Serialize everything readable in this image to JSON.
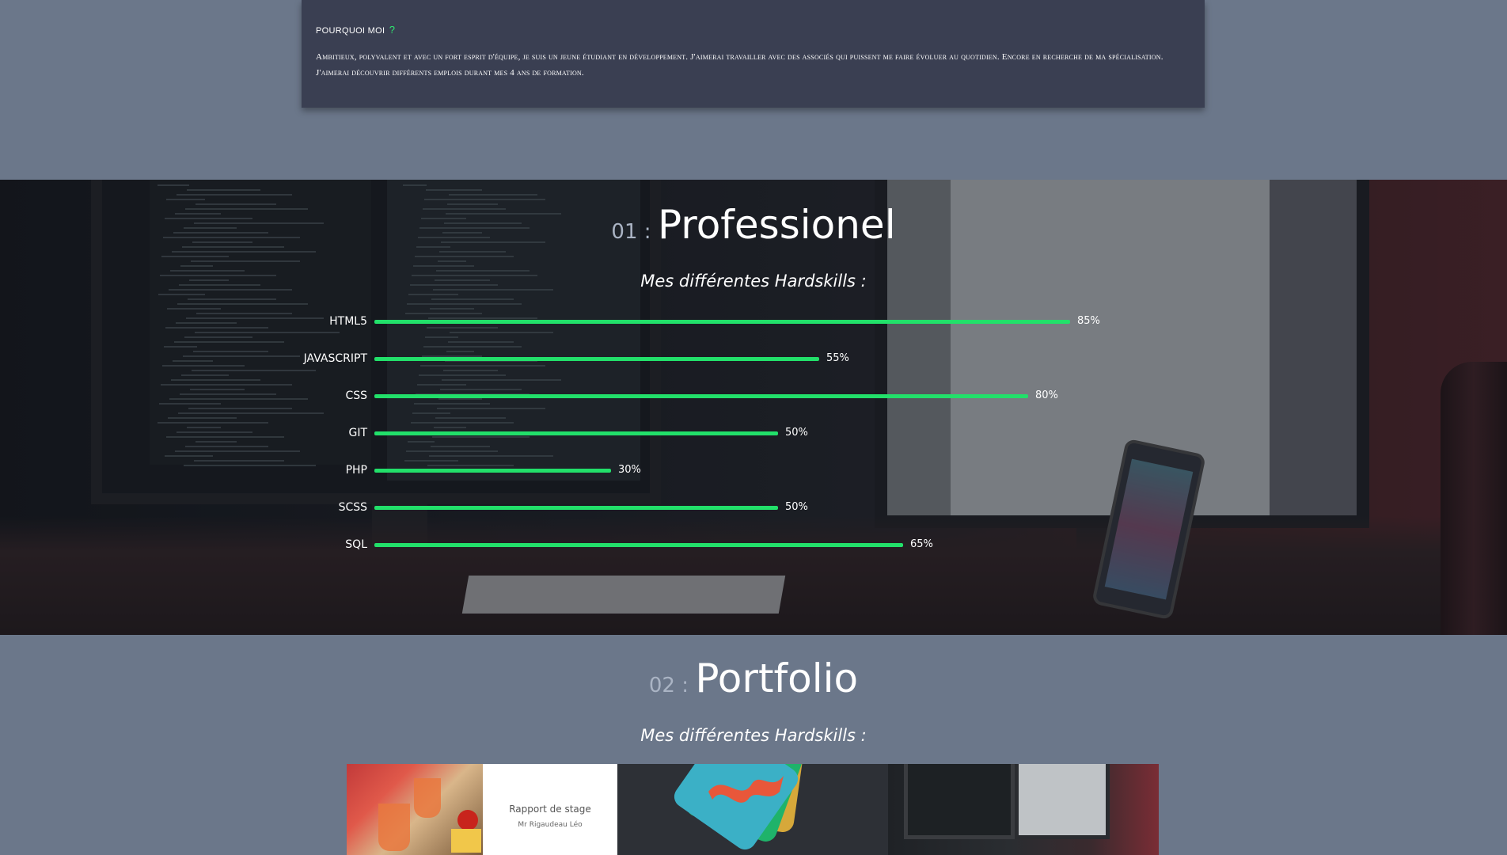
{
  "about": {
    "title": "POURQUOI MOI",
    "title_mark": "?",
    "text": "Ambitieux, polyvalent et avec un fort esprit d'équipe, je suis un jeune étudiant en développement. J'aimerai travailler avec des associés qui puissent me faire évoluer au quotidien. Encore en recherche de ma spécialisation. J'aimerai découvrir différents emplois durant mes 4 ans de formation."
  },
  "professional": {
    "number": "01 :",
    "title": "Professionel",
    "subtitle": "Mes différentes Hardskills :",
    "skills": [
      {
        "label": "HTML5",
        "percent": 85,
        "percent_text": "85%"
      },
      {
        "label": "JAVASCRIPT",
        "percent": 55,
        "percent_text": "55%"
      },
      {
        "label": "CSS",
        "percent": 80,
        "percent_text": "80%"
      },
      {
        "label": "GIT",
        "percent": 50,
        "percent_text": "50%"
      },
      {
        "label": "PHP",
        "percent": 30,
        "percent_text": "30%"
      },
      {
        "label": "SCSS",
        "percent": 50,
        "percent_text": "50%"
      },
      {
        "label": "SQL",
        "percent": 65,
        "percent_text": "65%"
      }
    ]
  },
  "portfolio": {
    "number": "02 :",
    "title": "Portfolio",
    "subtitle": "Mes différentes Hardskills :",
    "items": [
      {
        "caption_title": "Rapport de stage",
        "caption_author": "Mr Rigaudeau Léo"
      },
      {
        "icon": "logo-tiles-icon"
      },
      {
        "icon": "desk-setup-image"
      }
    ]
  },
  "colors": {
    "accent": "#22e06a",
    "card_bg": "#3a3f52",
    "page_bg": "#6b778a"
  }
}
